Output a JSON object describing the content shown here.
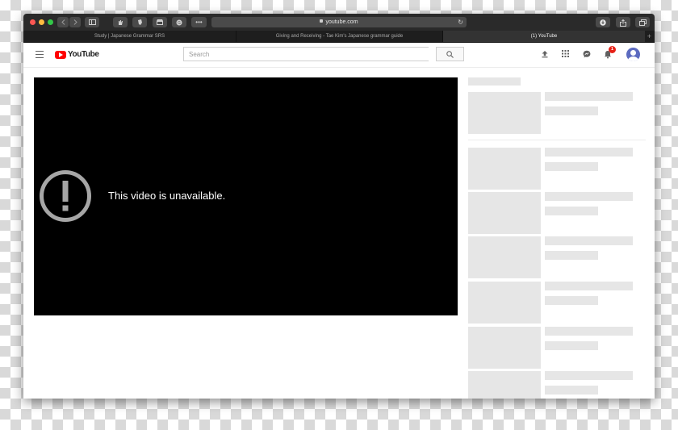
{
  "browser": {
    "url": "youtube.com",
    "more_label": "•••",
    "new_tab_label": "+",
    "tabs": [
      {
        "label": "Study | Japanese Grammar SRS",
        "active": false
      },
      {
        "label": "Giving and Receiving - Tae Kim's Japanese grammar guide",
        "active": false
      },
      {
        "label": "(1) YouTube",
        "active": true
      }
    ]
  },
  "youtube": {
    "logo_text": "YouTube",
    "search_placeholder": "Search",
    "notification_count": "1",
    "accent_color": "#ff0000"
  },
  "player": {
    "message": "This video is unavailable.",
    "background": "#000000"
  },
  "sidebar": {
    "placeholder_color": "#e6e6e6"
  }
}
